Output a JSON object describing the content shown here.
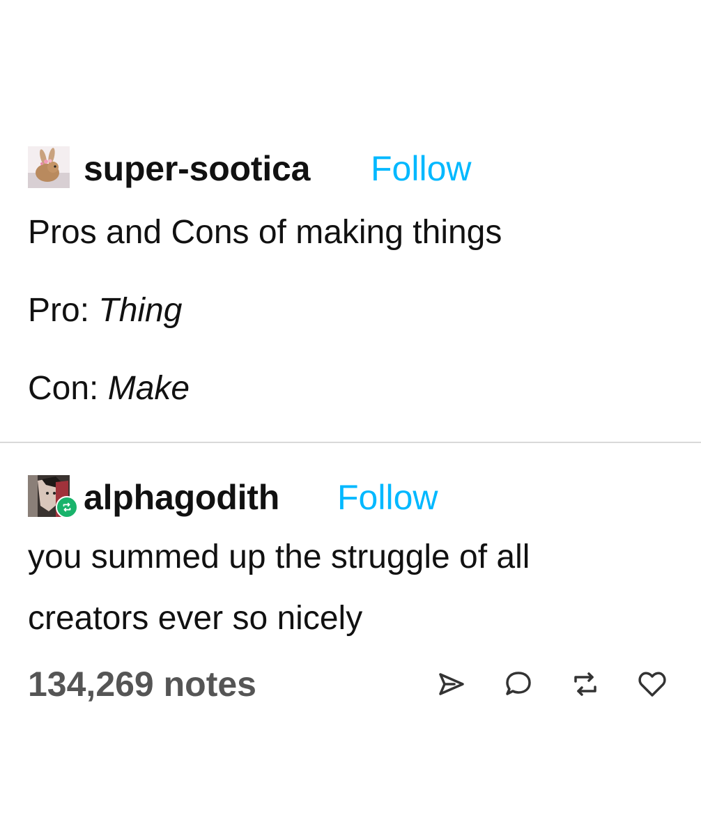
{
  "original_post": {
    "username": "super-sootica",
    "follow_label": "Follow",
    "title": "Pros and Cons of making things",
    "pro_label": "Pro:",
    "pro_value": "Thing",
    "con_label": "Con:",
    "con_value": "Make",
    "avatar_icon": "bunny-avatar-icon"
  },
  "reblog": {
    "username": "alphagodith",
    "follow_label": "Follow",
    "comment_line1": "you summed up the struggle of all",
    "comment_line2": "creators ever so nicely",
    "avatar_icon": "alphagodith-avatar-icon",
    "badge_icon": "reblog-badge-icon"
  },
  "footer": {
    "notes": "134,269 notes",
    "actions": [
      "share-icon",
      "reply-icon",
      "reblog-icon",
      "like-icon"
    ]
  },
  "colors": {
    "follow_blue": "#00b8ff",
    "notes_gray": "#555555",
    "reblog_badge_green": "#19b36b",
    "divider": "#d9d9d9"
  }
}
